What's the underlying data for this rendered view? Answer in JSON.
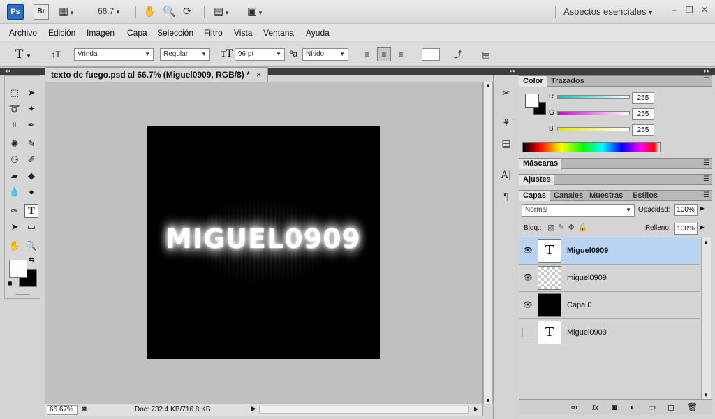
{
  "appbar": {
    "ps_logo": "Ps",
    "br_logo": "Br",
    "zoom": "66.7",
    "workspace": "Aspectos esenciales",
    "win_min": "–",
    "win_restore": "❐",
    "win_close": "✕"
  },
  "menu": [
    "Archivo",
    "Edición",
    "Imagen",
    "Capa",
    "Selección",
    "Filtro",
    "Vista",
    "Ventana",
    "Ayuda"
  ],
  "options": {
    "font_family": "Vrinda",
    "font_style": "Regular",
    "font_size": "96 pt",
    "antialias": "Nítido",
    "text_color": "#ffffff"
  },
  "document": {
    "tab_title": "texto de fuego.psd al 66.7% (Miguel0909, RGB/8) *",
    "tab_close": "×",
    "image_text": "MIGUEL0909",
    "zoom_status": "66.67%",
    "doc_info": "Doc: 732.4 KB/716.8 KB"
  },
  "color_panel": {
    "tabs": [
      "Color",
      "Trazados"
    ],
    "channels": [
      {
        "label": "R",
        "value": "255",
        "color": "#00c8c8"
      },
      {
        "label": "G",
        "value": "255",
        "color": "#d400d4"
      },
      {
        "label": "B",
        "value": "255",
        "color": "#e8e800"
      }
    ],
    "foreground": "#ffffff",
    "background": "#000000"
  },
  "masks_panel": {
    "tab": "Máscaras"
  },
  "adjust_panel": {
    "tab": "Ajustes"
  },
  "layers_panel": {
    "tabs": [
      "Capas",
      "Canales",
      "Muestras",
      "Estilos"
    ],
    "blend_mode": "Normal",
    "opacity_label": "Opacidad:",
    "opacity": "100%",
    "lock_label": "Bloq.:",
    "fill_label": "Relleno:",
    "fill": "100%",
    "layers": [
      {
        "name": "Miguel0909",
        "thumb": "T",
        "visible": true,
        "selected": true,
        "kind": "text"
      },
      {
        "name": "miguel0909",
        "thumb": "",
        "visible": true,
        "selected": false,
        "kind": "raster"
      },
      {
        "name": "Capa 0",
        "thumb": "",
        "visible": true,
        "selected": false,
        "kind": "black"
      },
      {
        "name": "Miguel0909",
        "thumb": "T",
        "visible": false,
        "selected": false,
        "kind": "text"
      }
    ]
  }
}
